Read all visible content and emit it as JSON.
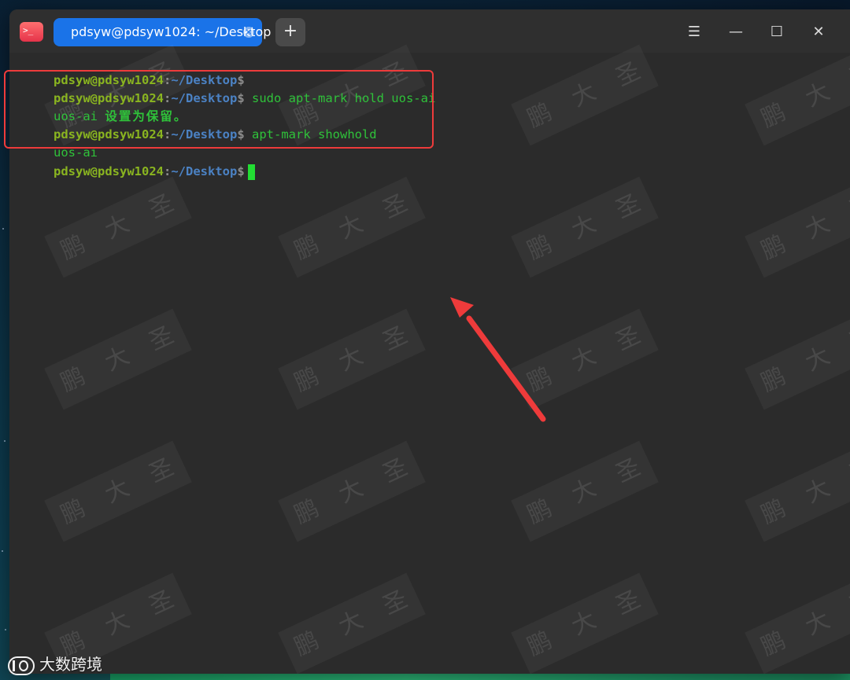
{
  "window": {
    "tab_title": "pdsyw@pdsyw1024: ~/Desktop",
    "tab_close_glyph": "×",
    "new_tab_glyph": "+",
    "menu_glyph": "☰",
    "minimize_glyph": "—",
    "maximize_glyph": "☐",
    "close_glyph": "✕",
    "app_icon_text": ">_"
  },
  "terminal": {
    "lines": [
      {
        "user": "pdsyw@pdsyw1024",
        "sep": ":",
        "path": "~/Desktop",
        "dollar": "$",
        "command": ""
      },
      {
        "user": "pdsyw@pdsyw1024",
        "sep": ":",
        "path": "~/Desktop",
        "dollar": "$",
        "command": " sudo apt-mark hold uos-ai"
      },
      {
        "output_prefix": "uos-ai ",
        "output_cn": "设置为保留。"
      },
      {
        "user": "pdsyw@pdsyw1024",
        "sep": ":",
        "path": "~/Desktop",
        "dollar": "$",
        "command": " apt-mark showhold"
      },
      {
        "output": "uos-ai"
      },
      {
        "user": "pdsyw@pdsyw1024",
        "sep": ":",
        "path": "~/Desktop",
        "dollar": "$",
        "command": ""
      }
    ]
  },
  "watermark": {
    "chars": [
      "鹏",
      "大",
      "圣"
    ]
  },
  "corner_logo": {
    "text": "大数跨境"
  },
  "colors": {
    "user": "#8ab520",
    "path": "#4b82c4",
    "command": "#2fc23a",
    "highlight": "#ee3b3b",
    "tab_active": "#1a73e8"
  },
  "icons": {
    "app_icon": "terminal-icon",
    "menu": "hamburger-icon",
    "minimize": "minimize-icon",
    "maximize": "maximize-icon",
    "close": "close-icon",
    "new_tab": "plus-icon"
  }
}
